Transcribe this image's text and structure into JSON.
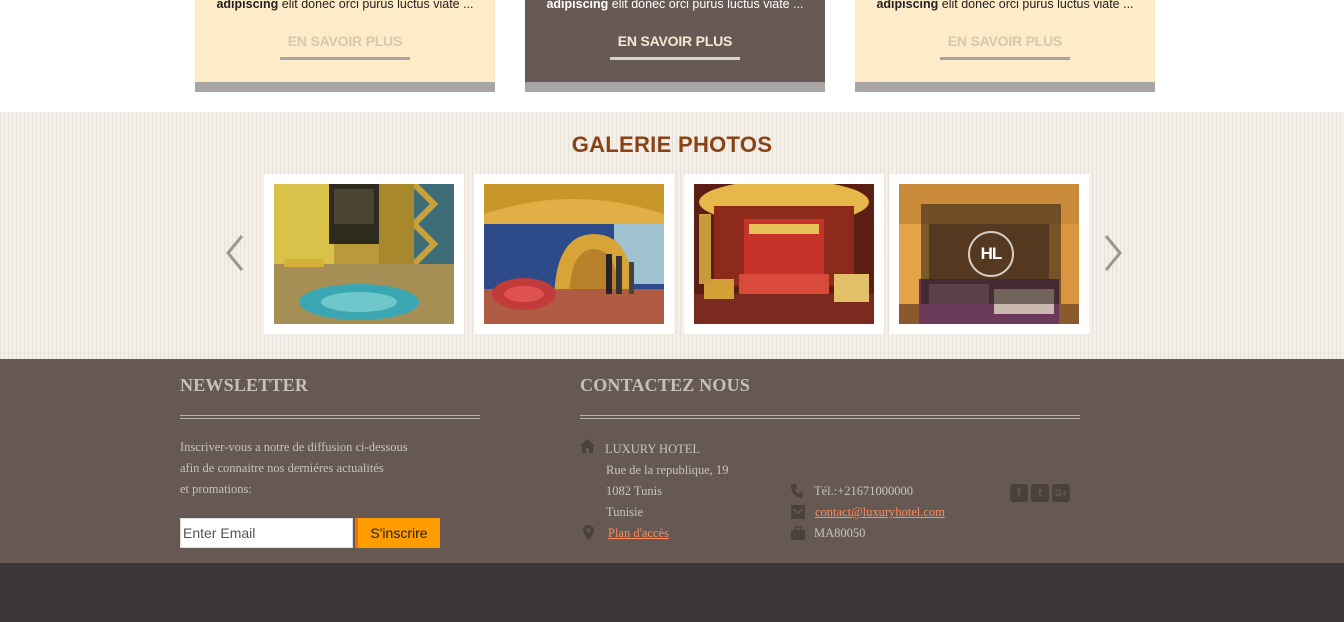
{
  "cards": [
    {
      "desc_bold": "adipiscing",
      "desc": " elit donec orci purus luctus viate ...",
      "more": "EN SAVOIR PLUS"
    },
    {
      "desc_bold": "adipiscing",
      "desc": " elit donec orci purus luctus viate ...",
      "more": "EN SAVOIR PLUS"
    },
    {
      "desc_bold": "adipiscing",
      "desc": " elit donec orci purus luctus viate ...",
      "more": "EN SAVOIR PLUS"
    }
  ],
  "gallery": {
    "title": "GALERIE PHOTOS",
    "prev_icon": "chevron-left-icon",
    "next_icon": "chevron-right-icon",
    "hover_badge": "HL"
  },
  "newsletter": {
    "title": "NEWSLETTER",
    "text_lines": [
      "Inscriver-vous a notre de diffusion ci-dessous",
      "afin de connaitre nos derniéres actualités",
      "et promations:"
    ],
    "email_placeholder": "Enter Email",
    "button": "S'inscrire"
  },
  "contact": {
    "title": "CONTACTEZ NOUS",
    "name": "LUXURY HOTEL",
    "address_lines": [
      "Rue de la republique, 19",
      "1082 Tunis",
      "Tunisie"
    ],
    "map_link": "Plan d'accès",
    "phone": "Tél.:+21671000000",
    "email": "contact@luxuryhotel.com",
    "code": "MA80050"
  },
  "social": {
    "facebook": "f",
    "twitter": "t",
    "googleplus": "G+"
  },
  "colors": {
    "accent_orange": "#ff9c00",
    "title_brown": "#8a4314",
    "footer_bg": "#665954",
    "card_cream": "#feebc8"
  }
}
